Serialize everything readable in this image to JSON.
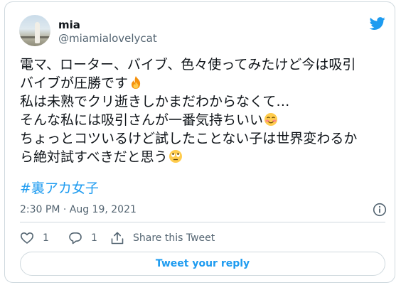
{
  "colors": {
    "accent": "#1d9bf0",
    "text": "#0f1419",
    "muted": "#536471",
    "border": "#cfd9de"
  },
  "author": {
    "name": "mia",
    "handle": "@miamialovelycat"
  },
  "tweet": {
    "lines": [
      {
        "text": "電マ、ローター、バイブ、色々使ってみたけど今は吸引",
        "emoji": ""
      },
      {
        "text": "バイブが圧勝です",
        "emoji": "fire-emoji"
      },
      {
        "text": "私は未熟でクリ逝きしかまだわからなくて…",
        "emoji": ""
      },
      {
        "text": "そんな私には吸引さんが一番気持ちいい",
        "emoji": "smiling-blush-emoji"
      },
      {
        "text": "ちょっとコツいるけど試したことない子は世界変わるか",
        "emoji": ""
      },
      {
        "text": "ら絶対試すべきだと思う",
        "emoji": "rolling-eyes-emoji"
      }
    ],
    "hashtag": "#裏アカ女子",
    "timestamp": "2:30 PM · Aug 19, 2021"
  },
  "actions": {
    "like_count": "1",
    "reply_count": "1",
    "share_label": "Share this Tweet"
  },
  "reply_button_label": "Tweet your reply",
  "icons": {
    "brand": "twitter-bird-icon",
    "info": "info-icon",
    "like": "heart-icon",
    "reply": "reply-bubble-icon",
    "share": "share-icon"
  }
}
